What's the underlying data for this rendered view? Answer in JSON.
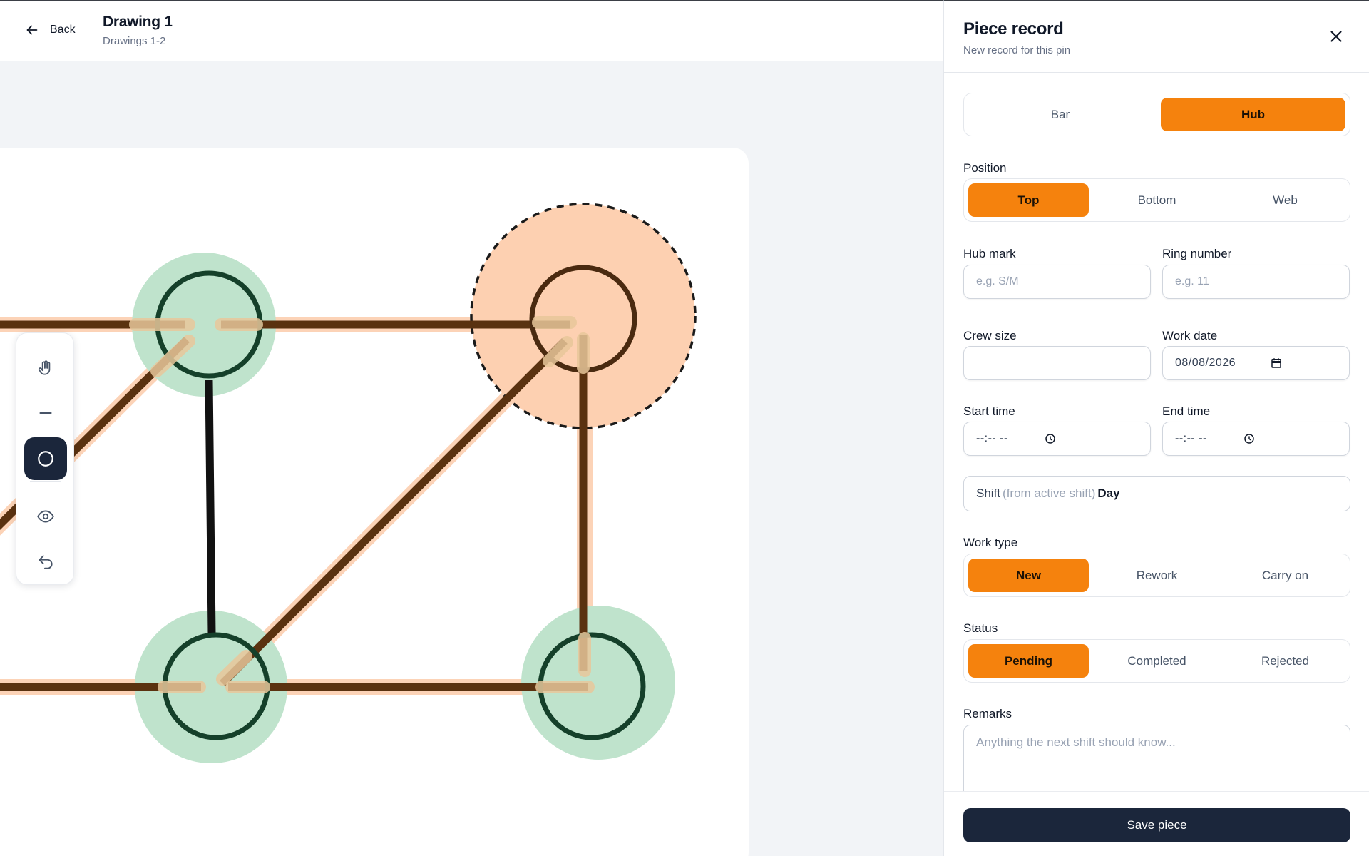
{
  "header": {
    "back_label": "Back",
    "title": "Drawing 1",
    "subtitle": "Drawings 1-2"
  },
  "toolbar": {
    "tools": [
      {
        "icon": "hand-icon",
        "active": false
      },
      {
        "icon": "line-icon",
        "active": false
      },
      {
        "icon": "circle-icon",
        "active": true
      },
      {
        "icon": "eye-icon",
        "active": false
      },
      {
        "icon": "undo-icon",
        "active": false
      }
    ]
  },
  "colors": {
    "accent": "#f5820d",
    "dark": "#1b263b",
    "hub_done_fill": "#bfe3cc",
    "hub_done_stroke": "#15402a",
    "hub_selected_fill": "#fdd0b1",
    "bar_stroke": "#5a3210",
    "bar_halo": "#fcd3b7"
  },
  "panel": {
    "title": "Piece record",
    "subtitle": "New record for this pin",
    "type_options": [
      {
        "label": "Bar",
        "selected": false
      },
      {
        "label": "Hub",
        "selected": true
      }
    ],
    "position": {
      "label": "Position",
      "options": [
        {
          "label": "Top",
          "selected": true
        },
        {
          "label": "Bottom",
          "selected": false
        },
        {
          "label": "Web",
          "selected": false
        }
      ]
    },
    "hub_mark": {
      "label": "Hub mark",
      "value": "",
      "placeholder": "e.g. S/M"
    },
    "ring_number": {
      "label": "Ring number",
      "value": "",
      "placeholder": "e.g. 11"
    },
    "crew_size": {
      "label": "Crew size",
      "value": ""
    },
    "work_date": {
      "label": "Work date",
      "value": "08/08/2026"
    },
    "start_time": {
      "label": "Start time",
      "value": "--:-- --"
    },
    "end_time": {
      "label": "End time",
      "value": "--:-- --"
    },
    "shift": {
      "key": "Shift",
      "meta": "(from active shift)",
      "value": "Day"
    },
    "work_type": {
      "label": "Work type",
      "options": [
        {
          "label": "New",
          "selected": true
        },
        {
          "label": "Rework",
          "selected": false
        },
        {
          "label": "Carry on",
          "selected": false
        }
      ]
    },
    "status": {
      "label": "Status",
      "options": [
        {
          "label": "Pending",
          "selected": true
        },
        {
          "label": "Completed",
          "selected": false
        },
        {
          "label": "Rejected",
          "selected": false
        }
      ]
    },
    "remarks": {
      "label": "Remarks",
      "placeholder": "Anything the next shift should know..."
    },
    "save_label": "Save piece"
  }
}
